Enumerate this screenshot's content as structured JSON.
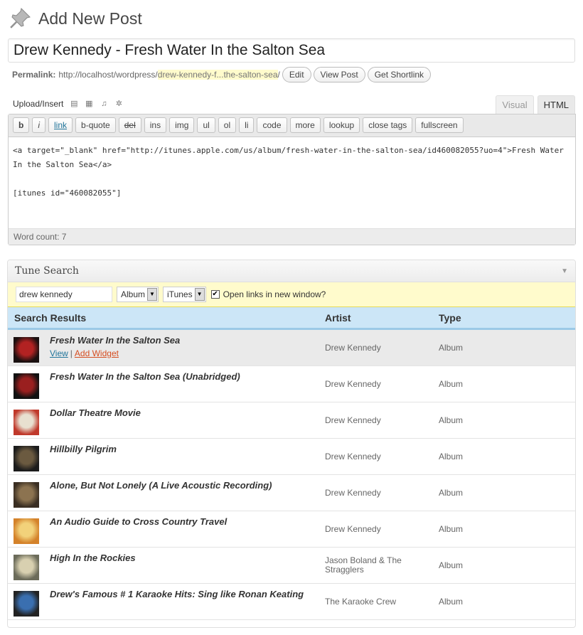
{
  "header": {
    "title": "Add New Post"
  },
  "post": {
    "title": "Drew Kennedy - Fresh Water In the Salton Sea"
  },
  "permalink": {
    "label": "Permalink:",
    "base": "http://localhost/wordpress/",
    "slug": "drew-kennedy-f...the-salton-sea",
    "suffix": "/",
    "buttons": {
      "edit": "Edit",
      "view": "View Post",
      "shortlink": "Get Shortlink"
    }
  },
  "upload": {
    "label": "Upload/Insert"
  },
  "tabs": {
    "visual": "Visual",
    "html": "HTML"
  },
  "toolbar": {
    "b": "b",
    "i": "i",
    "link": "link",
    "bquote": "b-quote",
    "del": "del",
    "ins": "ins",
    "img": "img",
    "ul": "ul",
    "ol": "ol",
    "li": "li",
    "code": "code",
    "more": "more",
    "lookup": "lookup",
    "close_tags": "close tags",
    "fullscreen": "fullscreen"
  },
  "editor": {
    "content": "<a target=\"_blank\" href=\"http://itunes.apple.com/us/album/fresh-water-in-the-salton-sea/id460082055?uo=4\">Fresh Water In the Salton Sea</a>\n\n[itunes id=\"460082055\"]",
    "word_count": "Word count: 7"
  },
  "tune_search": {
    "title": "Tune Search",
    "query": "drew kennedy",
    "type_select": "Album",
    "store_select": "iTunes",
    "open_new_window_label": "Open links in new window?",
    "open_new_window_checked": true,
    "columns": {
      "results": "Search Results",
      "artist": "Artist",
      "type": "Type"
    },
    "actions": {
      "view": "View",
      "sep": "|",
      "add": "Add Widget"
    },
    "results": [
      {
        "title": "Fresh Water In the Salton Sea",
        "artist": "Drew Kennedy",
        "type": "Album",
        "thumb_colors": [
          "#1a1010",
          "#b22222"
        ]
      },
      {
        "title": "Fresh Water In the Salton Sea (Unabridged)",
        "artist": "Drew Kennedy",
        "type": "Album",
        "thumb_colors": [
          "#111111",
          "#9a1f1f"
        ]
      },
      {
        "title": "Dollar Theatre Movie",
        "artist": "Drew Kennedy",
        "type": "Album",
        "thumb_colors": [
          "#c0392b",
          "#e8e0d0"
        ]
      },
      {
        "title": "Hillbilly Pilgrim",
        "artist": "Drew Kennedy",
        "type": "Album",
        "thumb_colors": [
          "#1c1c1c",
          "#6b5a40"
        ]
      },
      {
        "title": "Alone, But Not Lonely (A Live Acoustic Recording)",
        "artist": "Drew Kennedy",
        "type": "Album",
        "thumb_colors": [
          "#3a2e22",
          "#8c7350"
        ]
      },
      {
        "title": "An Audio Guide to Cross Country Travel",
        "artist": "Drew Kennedy",
        "type": "Album",
        "thumb_colors": [
          "#d4822a",
          "#f2d27a"
        ]
      },
      {
        "title": "High In the Rockies",
        "artist": "Jason Boland & The Stragglers",
        "type": "Album",
        "thumb_colors": [
          "#6b6b5a",
          "#d8d0b0"
        ]
      },
      {
        "title": "Drew's Famous # 1 Karaoke Hits: Sing like Ronan Keating",
        "artist": "The Karaoke Crew",
        "type": "Album",
        "thumb_colors": [
          "#222222",
          "#3a6fb0"
        ]
      }
    ]
  }
}
